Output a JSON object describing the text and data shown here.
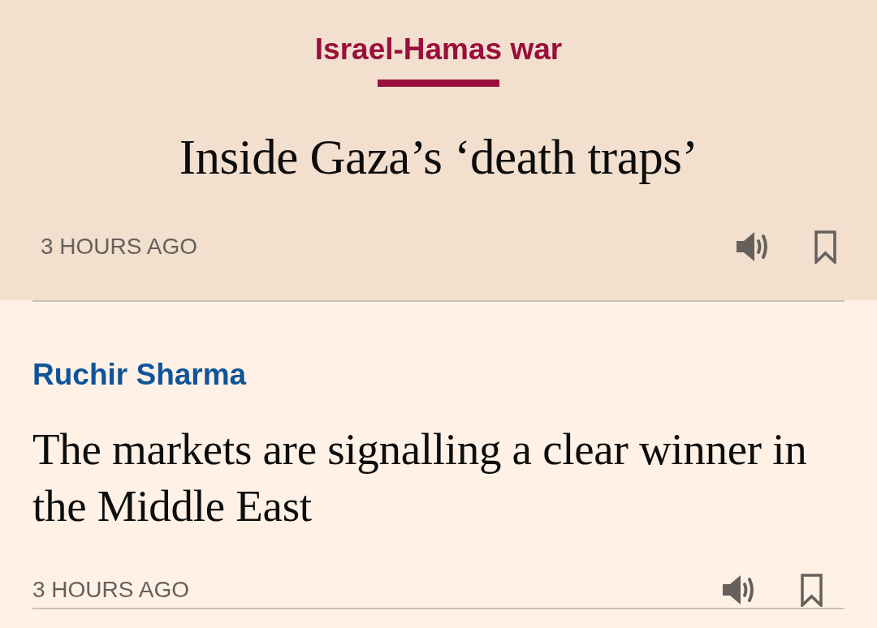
{
  "articles": [
    {
      "kind": "featured",
      "topic": "Israel-Hamas war",
      "headline": "Inside Gaza’s ‘death traps’",
      "time": "3 HOURS AGO"
    },
    {
      "kind": "standard",
      "topic": "Ruchir Sharma",
      "headline": "The markets are signalling a clear winner in the Middle East",
      "time": "3 HOURS AGO"
    }
  ]
}
